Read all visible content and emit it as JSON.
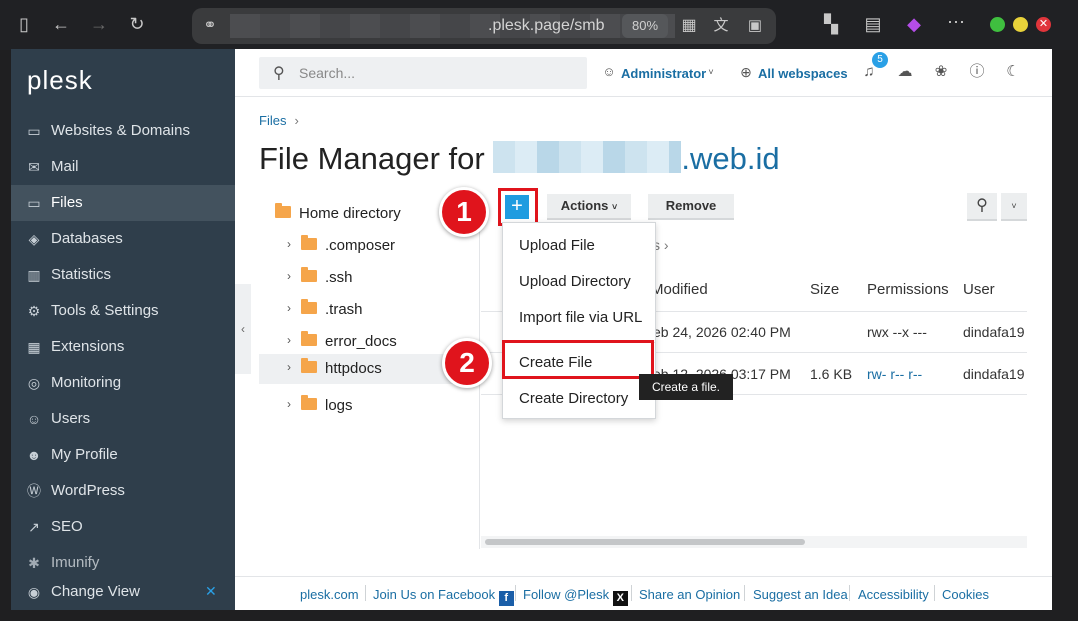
{
  "browser": {
    "url_text": ".plesk.page/smb",
    "zoom": "80%"
  },
  "sidebar": {
    "logo": "plesk",
    "items": [
      {
        "label": "Websites & Domains",
        "icon": "monitor-icon"
      },
      {
        "label": "Mail",
        "icon": "mail-icon"
      },
      {
        "label": "Files",
        "icon": "folder-icon"
      },
      {
        "label": "Databases",
        "icon": "database-icon"
      },
      {
        "label": "Statistics",
        "icon": "statistics-icon"
      },
      {
        "label": "Tools & Settings",
        "icon": "sliders-icon"
      },
      {
        "label": "Extensions",
        "icon": "extensions-icon"
      },
      {
        "label": "Monitoring",
        "icon": "monitoring-icon"
      },
      {
        "label": "Users",
        "icon": "user-icon"
      },
      {
        "label": "My Profile",
        "icon": "profile-icon"
      },
      {
        "label": "WordPress",
        "icon": "wordpress-icon"
      },
      {
        "label": "SEO",
        "icon": "seo-icon"
      },
      {
        "label": "Imunify",
        "icon": "imunify-icon"
      }
    ],
    "change_view": "Change View"
  },
  "topbar": {
    "search_placeholder": "Search...",
    "user": "Administrator",
    "webspaces": "All webspaces",
    "notifications_count": "5"
  },
  "breadcrumb": "Files",
  "page": {
    "title_prefix": "File Manager for",
    "title_domain": ".web.id"
  },
  "tree": {
    "root": "Home directory",
    "folders": [
      ".composer",
      ".ssh",
      ".trash",
      "error_docs",
      "httpdocs",
      "logs"
    ]
  },
  "toolbar": {
    "add": "+",
    "actions": "Actions",
    "remove": "Remove"
  },
  "table": {
    "path_fragment": "s",
    "columns": [
      "Modified",
      "Size",
      "Permissions",
      "User"
    ],
    "rows": [
      {
        "modified": "eb 24, 2026 02:40 PM",
        "size": "",
        "permissions": "rwx --x ---",
        "user": "dindafa19"
      },
      {
        "modified": "eb 12, 2026 03:17 PM",
        "size": "1.6 KB",
        "permissions": "rw- r-- r--",
        "user": "dindafa19"
      }
    ]
  },
  "menu": {
    "items": [
      "Upload File",
      "Upload Directory",
      "Import file via URL",
      "Create File",
      "Create Directory"
    ],
    "tooltip": "Create a file."
  },
  "annotations": {
    "step1": "1",
    "step2": "2"
  },
  "footer": {
    "links": [
      "plesk.com",
      "Join Us on Facebook",
      "Follow @Plesk",
      "Share an Opinion",
      "Suggest an Idea",
      "Accessibility",
      "Cookies"
    ]
  }
}
